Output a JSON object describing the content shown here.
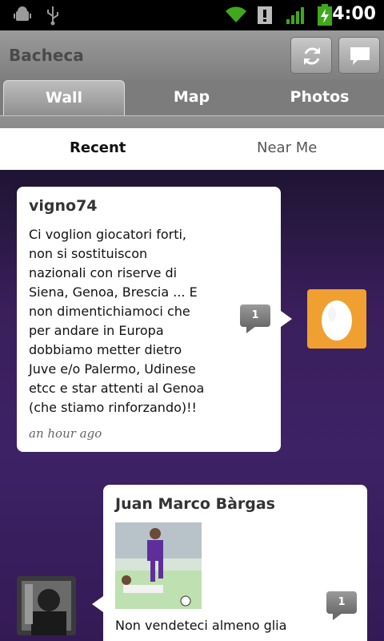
{
  "status_bar": {
    "time": "4:00",
    "icons": [
      "android-debug-icon",
      "usb-icon",
      "wifi-icon",
      "alert-icon",
      "signal-icon",
      "battery-charging-icon"
    ]
  },
  "app_bar": {
    "title": "Bacheca",
    "refresh_icon": "refresh-icon",
    "compose_icon": "comment-compose-icon"
  },
  "tabs": [
    {
      "label": "Wall",
      "active": true
    },
    {
      "label": "Map",
      "active": false
    },
    {
      "label": "Photos",
      "active": false
    }
  ],
  "subtabs": [
    {
      "label": "Recent",
      "active": true
    },
    {
      "label": "Near Me",
      "active": false
    }
  ],
  "posts": [
    {
      "author": "vigno74",
      "body_lines": [
        "Ci voglion giocatori forti,",
        "non si sostituiscon",
        "nazionali con riserve di",
        "Siena, Genoa, Brescia ... E",
        "non dimentichiamoci che",
        "per andare in Europa",
        "dobbiamo metter dietro",
        "Juve e/o Palermo, Udinese",
        "etcc e star attenti al Genoa",
        "(che stiamo rinforzando)!!"
      ],
      "time": "an hour ago",
      "comment_count": "1",
      "avatar_icon": "egg-avatar-icon",
      "avatar_color": "#f0a030"
    },
    {
      "author": "Juan Marco Bàrgas",
      "body_lines": [
        "Non vendeteci almeno glia"
      ],
      "comment_count": "1",
      "photo_icon": "football-photo"
    }
  ]
}
